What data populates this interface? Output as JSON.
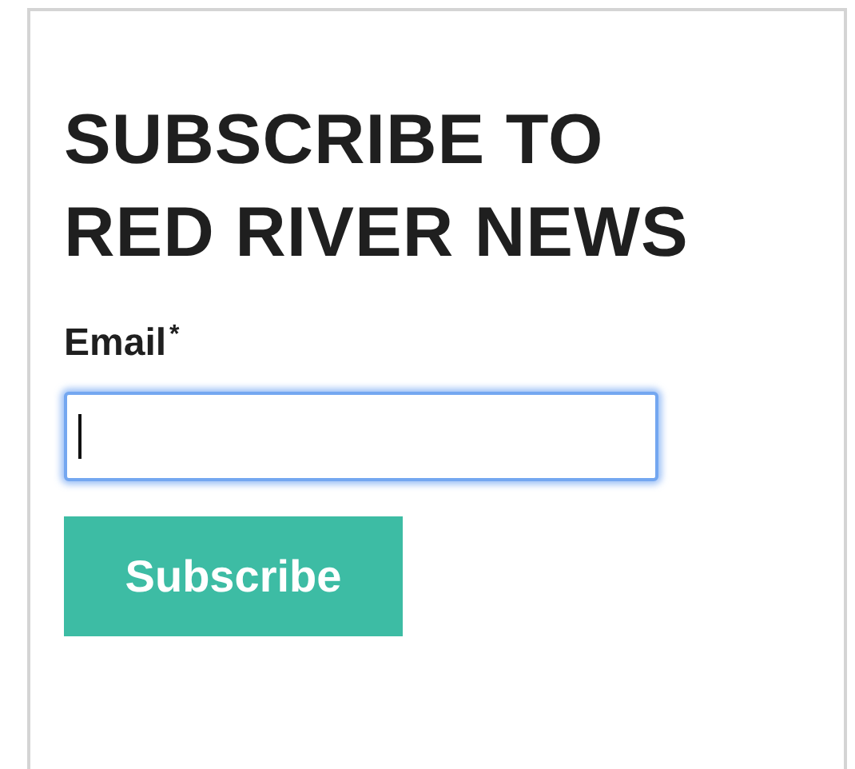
{
  "heading": "SUBSCRIBE TO RED RIVER NEWS",
  "form": {
    "label": "Email",
    "required_mark": "*",
    "field": {
      "focused": true
    },
    "button": "Subscribe"
  }
}
